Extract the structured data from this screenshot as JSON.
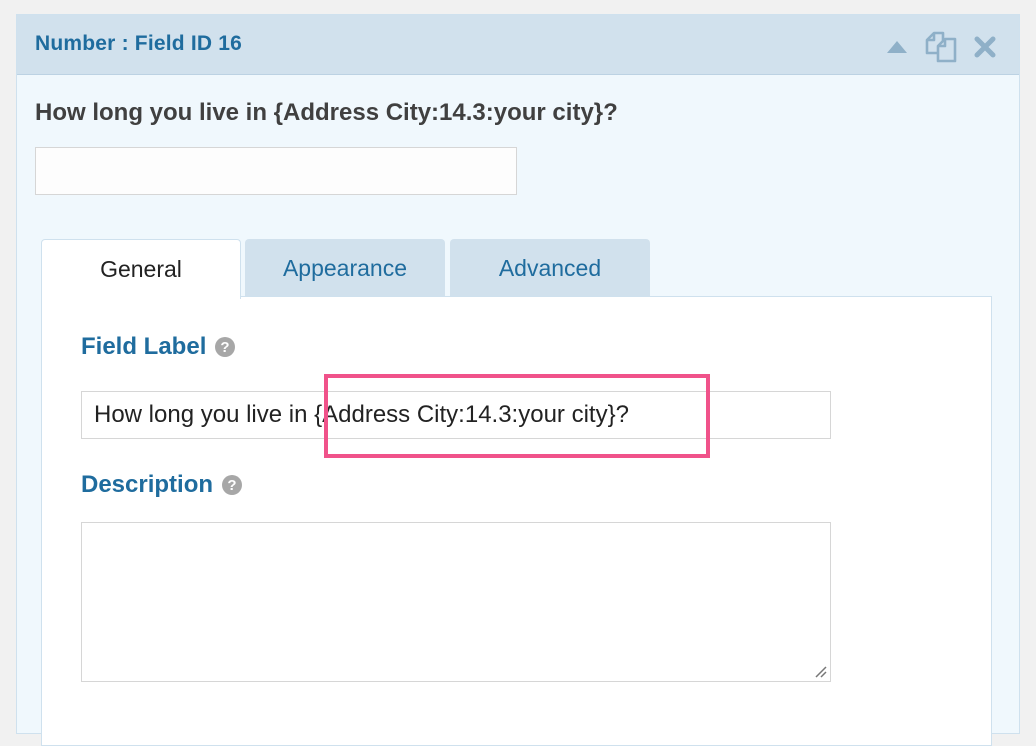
{
  "panel": {
    "title": "Number : Field ID 16",
    "icons": {
      "collapse": "collapse-up-icon",
      "duplicate": "duplicate-icon",
      "delete": "close-icon"
    }
  },
  "preview": {
    "label": "How long you live in {Address City:14.3:your city}?",
    "input_value": ""
  },
  "tabs": [
    {
      "label": "General",
      "active": true
    },
    {
      "label": "Appearance",
      "active": false
    },
    {
      "label": "Advanced",
      "active": false
    }
  ],
  "general": {
    "field_label_title": "Field Label",
    "field_label_value": "How long you live in {Address City:14.3:your city}?",
    "description_title": "Description",
    "description_value": "",
    "help_icon": "question-circle-icon"
  },
  "colors": {
    "accent": "#1f6c9e",
    "header_bg": "#d1e1ed",
    "panel_bg": "#f0f8fd",
    "highlight": "#f0528a"
  }
}
